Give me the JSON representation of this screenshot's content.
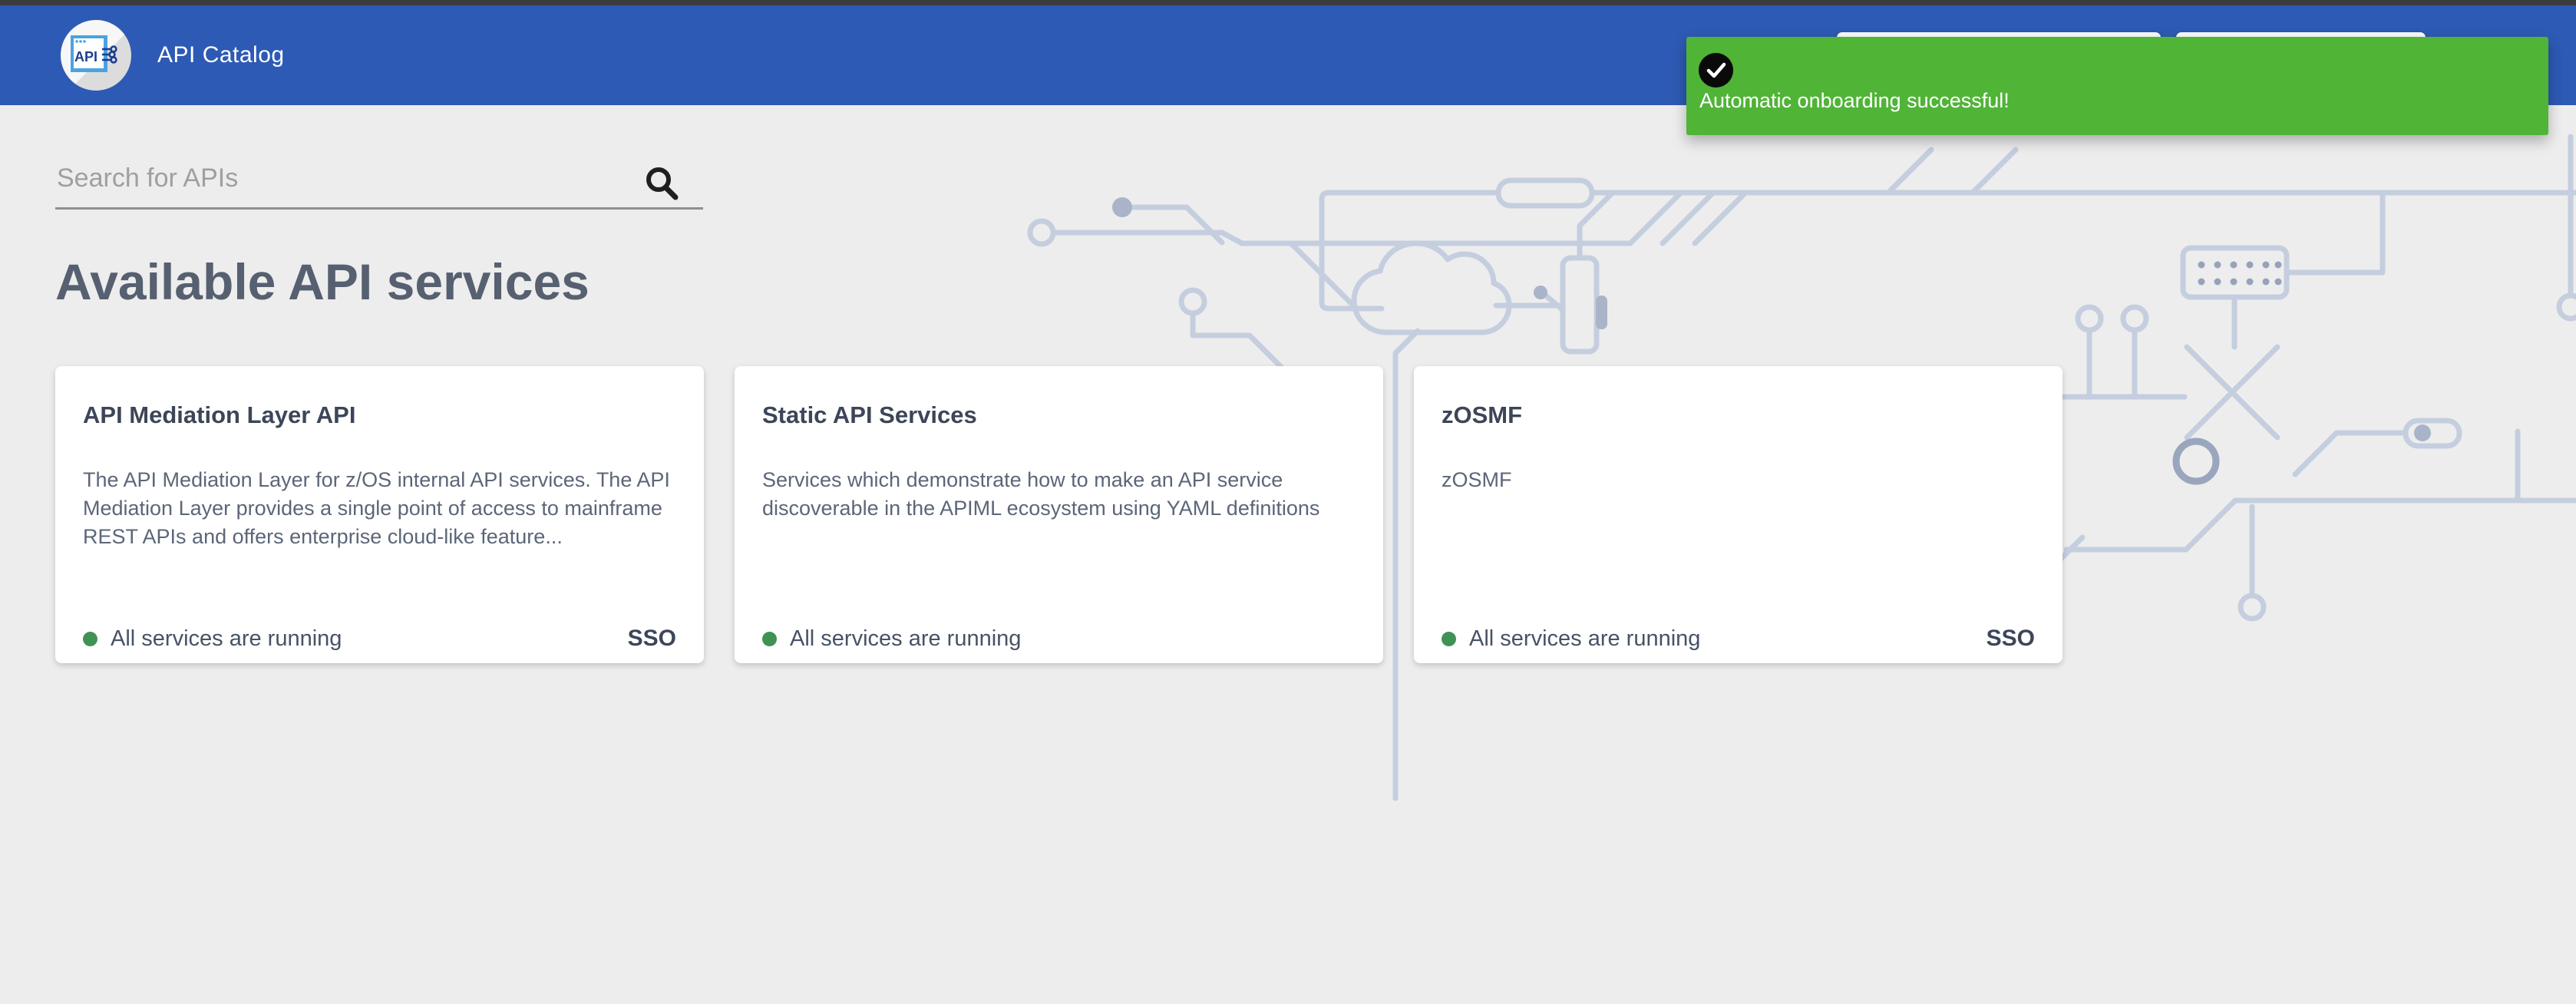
{
  "header": {
    "app_title": "API Catalog",
    "logo_text": "API",
    "background": "#2d5ab4"
  },
  "toast": {
    "icon": "check-circle-icon",
    "message": "Automatic onboarding successful!",
    "background": "#50b437"
  },
  "search": {
    "placeholder": "Search for APIs",
    "value": ""
  },
  "page": {
    "heading": "Available API services"
  },
  "cards": [
    {
      "title": "API Mediation Layer API",
      "description": "The API Mediation Layer for z/OS internal API services. The API Mediation Layer provides a single point of access to mainframe REST APIs and offers enterprise cloud-like feature...",
      "status": "All services are running",
      "status_color": "#3f9254",
      "sso": "SSO"
    },
    {
      "title": "Static API Services",
      "description": "Services which demonstrate how to make an API service discoverable in the APIML ecosystem using YAML definitions",
      "status": "All services are running",
      "status_color": "#3f9254",
      "sso": ""
    },
    {
      "title": "zOSMF",
      "description": "zOSMF",
      "status": "All services are running",
      "status_color": "#3f9254",
      "sso": "SSO"
    }
  ]
}
